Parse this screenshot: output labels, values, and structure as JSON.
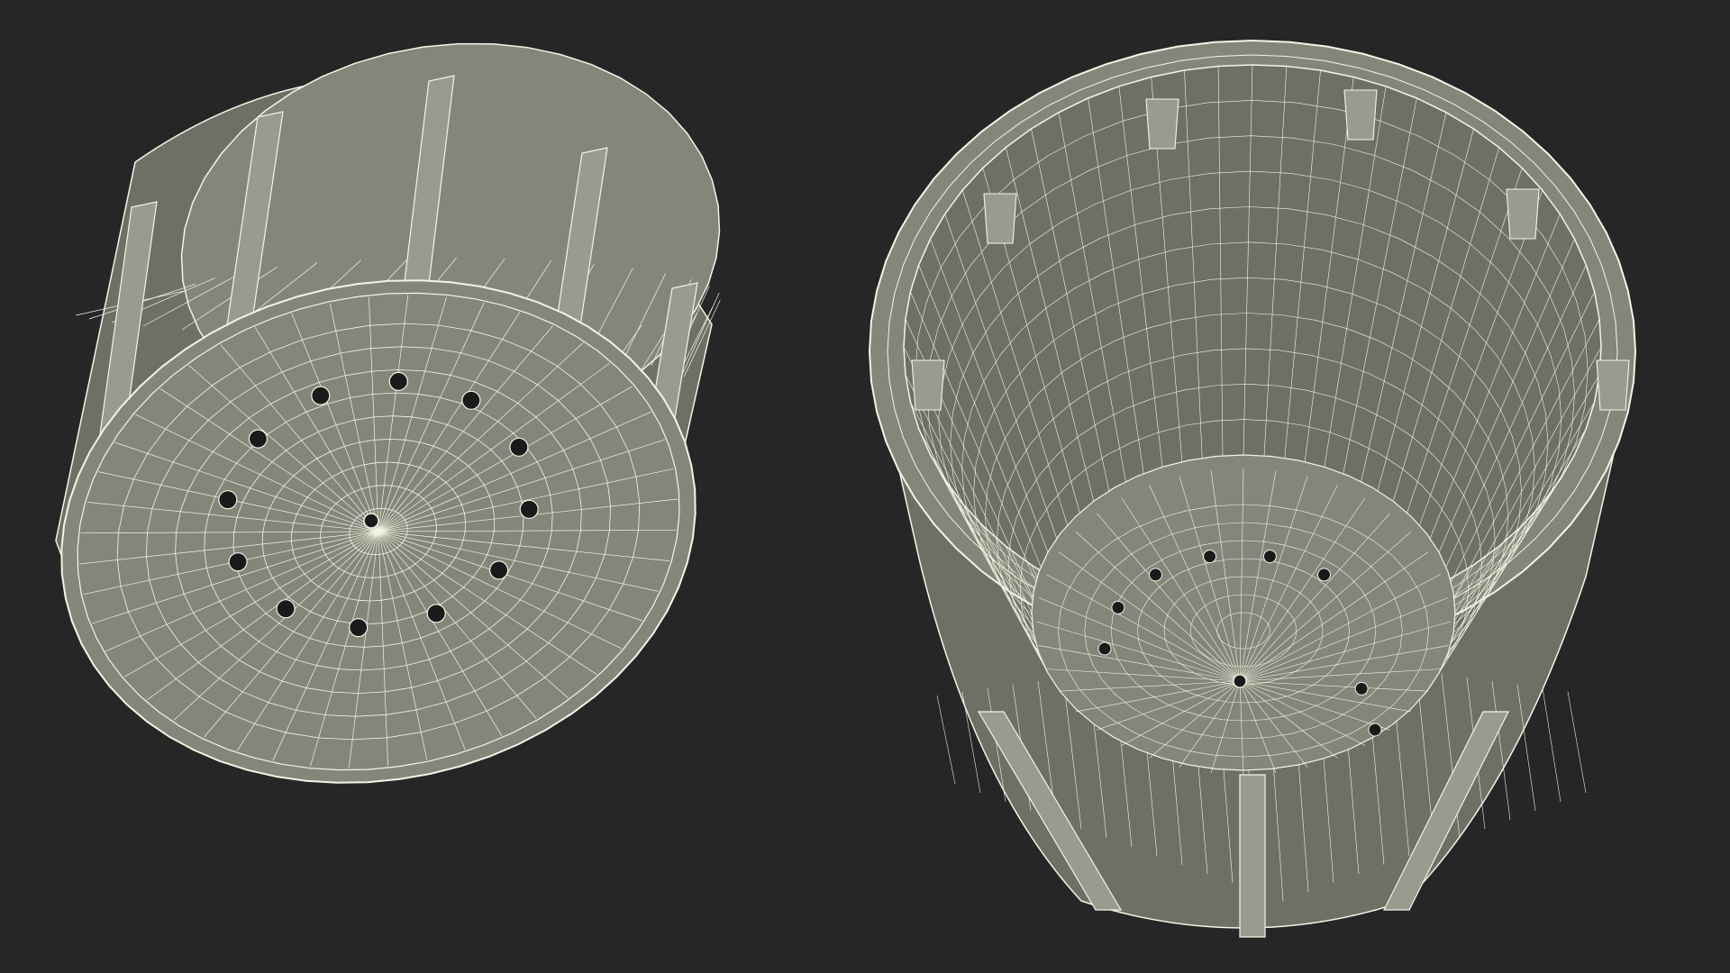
{
  "scene": {
    "background": "#262626",
    "surface": "#858579",
    "surface_dark": "#6f6f65",
    "surface_light": "#9a9a8e",
    "wire": "#f4f4e6",
    "hole": "#1a1a1a"
  },
  "views": [
    {
      "id": "bottom-view",
      "hole_count": 12
    },
    {
      "id": "top-view",
      "hole_count": 8
    }
  ]
}
